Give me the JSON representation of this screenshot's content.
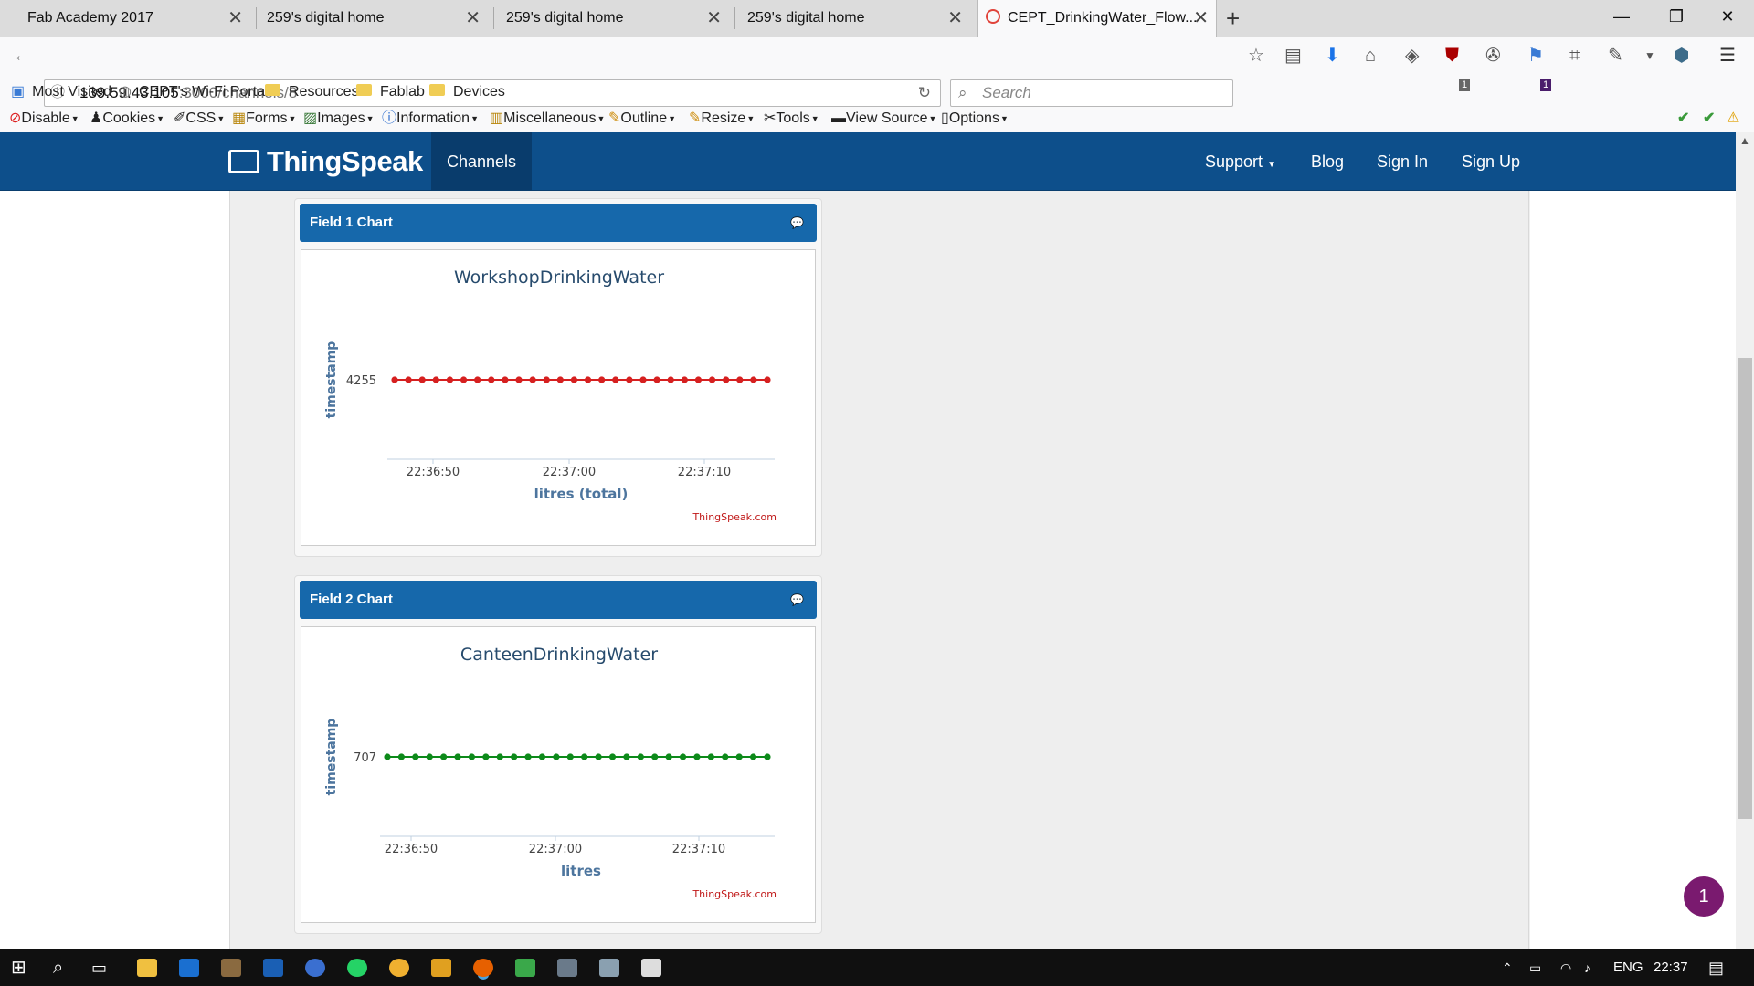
{
  "browser": {
    "tabs": [
      {
        "title": "Fab Academy 2017",
        "close": "✕"
      },
      {
        "title": "259's digital home",
        "close": "✕"
      },
      {
        "title": "259's digital home",
        "close": "✕"
      },
      {
        "title": "259's digital home",
        "close": "✕"
      },
      {
        "title": "CEPT_DrinkingWater_Flow...",
        "close": "✕",
        "active": true
      }
    ],
    "new_tab": "+",
    "window_controls": {
      "minimize": "—",
      "restore": "❐",
      "close": "✕"
    },
    "url_host": "139.59.43.105",
    "url_rest": ":3000/channels/8",
    "search_placeholder": "Search",
    "bookmarks": [
      "Most Visited",
      "CEPT's Wi-Fi Portal",
      "Resources",
      "Fablab",
      "Devices"
    ],
    "devtools": [
      "Disable",
      "Cookies",
      "CSS",
      "Forms",
      "Images",
      "Information",
      "Miscellaneous",
      "Outline",
      "Resize",
      "Tools",
      "View Source",
      "Options"
    ],
    "badges": {
      "ublock": "1",
      "notif": "1"
    }
  },
  "site": {
    "logo": "ThingSpeak",
    "nav_active": "Channels",
    "nav_links": {
      "support": "Support",
      "blog": "Blog",
      "signin": "Sign In",
      "signup": "Sign Up"
    }
  },
  "panels": [
    {
      "heading": "Field 1 Chart",
      "credit": "ThingSpeak.com"
    },
    {
      "heading": "Field 2 Chart",
      "credit": "ThingSpeak.com"
    }
  ],
  "chart_data": [
    {
      "type": "line",
      "title": "WorkshopDrinkingWater",
      "xlabel": "litres (total)",
      "ylabel": "timestamp",
      "color": "#d62020",
      "x_ticks": [
        "22:36:50",
        "22:37:00",
        "22:37:10"
      ],
      "y_ticks": [
        "4255"
      ],
      "series": [
        {
          "values": [
            4255,
            4255,
            4255,
            4255,
            4255,
            4255,
            4255,
            4255,
            4255,
            4255,
            4255,
            4255,
            4255,
            4255,
            4255,
            4255,
            4255,
            4255,
            4255,
            4255,
            4255,
            4255,
            4255,
            4255,
            4255,
            4255,
            4255,
            4255
          ]
        }
      ]
    },
    {
      "type": "line",
      "title": "CanteenDrinkingWater",
      "xlabel": "litres",
      "ylabel": "timestamp",
      "color": "#0d8a1a",
      "x_ticks": [
        "22:36:50",
        "22:37:00",
        "22:37:10"
      ],
      "y_ticks": [
        "707"
      ],
      "series": [
        {
          "values": [
            707,
            707,
            707,
            707,
            707,
            707,
            707,
            707,
            707,
            707,
            707,
            707,
            707,
            707,
            707,
            707,
            707,
            707,
            707,
            707,
            707,
            707,
            707,
            707,
            707,
            707,
            707,
            707
          ]
        }
      ]
    }
  ],
  "fab_count": "1",
  "taskbar": {
    "lang": "ENG",
    "time": "22:37"
  }
}
